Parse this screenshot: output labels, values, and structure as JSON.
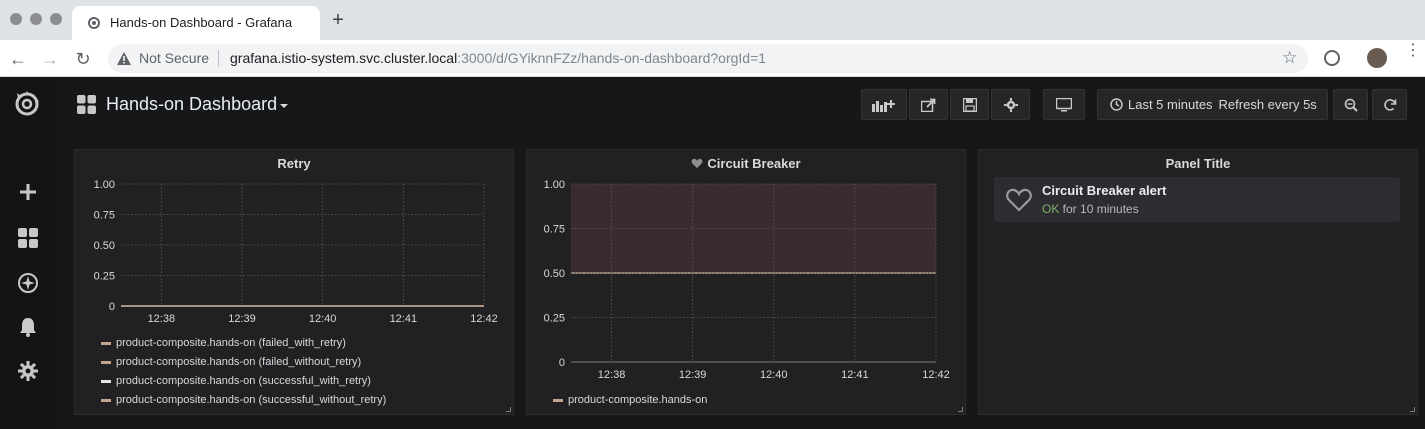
{
  "browser": {
    "tab_title": "Hands-on Dashboard - Grafana",
    "new_tab_label": "+",
    "security_label": "Not Secure",
    "url_host": "grafana.istio-system.svc.cluster.local",
    "url_rest": ":3000/d/GYiknnFZz/hands-on-dashboard?orgId=1"
  },
  "dashboard": {
    "title": "Hands-on Dashboard",
    "time_range": "Last 5 minutes",
    "refresh": "Refresh every 5s"
  },
  "sidebar": {
    "items": [
      {
        "icon": "grafana-logo-icon"
      },
      {
        "icon": "plus-icon"
      },
      {
        "icon": "dashboards-icon"
      },
      {
        "icon": "explore-compass-icon"
      },
      {
        "icon": "bell-icon"
      },
      {
        "icon": "gear-icon"
      }
    ]
  },
  "toolbar_buttons": [
    "add-panel-icon",
    "share-icon",
    "save-icon",
    "gear-icon",
    "tv-icon",
    "clock-icon",
    "zoom-out-icon",
    "refresh-icon"
  ],
  "panels": {
    "retry": {
      "title": "Retry",
      "legend": [
        "product-composite.hands-on (failed_with_retry)",
        "product-composite.hands-on (failed_without_retry)",
        "product-composite.hands-on (successful_with_retry)",
        "product-composite.hands-on (successful_without_retry)"
      ]
    },
    "circuit_breaker": {
      "title": "Circuit Breaker",
      "legend": [
        "product-composite.hands-on"
      ]
    },
    "alert_list": {
      "title": "Panel Title",
      "alert_name": "Circuit Breaker alert",
      "alert_state": "OK",
      "alert_duration": " for 10 minutes"
    }
  },
  "colors": {
    "legend_series": [
      "#c4a38b",
      "#c4a38b",
      "#e8e6e3",
      "#c4a38b"
    ],
    "ok": "#7eb26d",
    "threshold_fill": "#3f2c30",
    "threshold_line": "#b8a78e"
  },
  "chart_data": [
    {
      "type": "line",
      "title": "Retry",
      "x": [
        "12:38",
        "12:39",
        "12:40",
        "12:41",
        "12:42"
      ],
      "ylim": [
        0,
        1
      ],
      "yticks": [
        "1.00",
        "0.75",
        "0.50",
        "0.25",
        "0"
      ],
      "series": [
        {
          "name": "product-composite.hands-on (failed_with_retry)",
          "values": [
            0,
            0,
            0,
            0,
            0
          ]
        },
        {
          "name": "product-composite.hands-on (failed_without_retry)",
          "values": [
            0,
            0,
            0,
            0,
            0
          ]
        },
        {
          "name": "product-composite.hands-on (successful_with_retry)",
          "values": [
            0,
            0,
            0,
            0,
            0
          ]
        },
        {
          "name": "product-composite.hands-on (successful_without_retry)",
          "values": [
            0,
            0,
            0,
            0,
            0
          ]
        }
      ],
      "grid": true,
      "legend": "bottom"
    },
    {
      "type": "line",
      "title": "Circuit Breaker",
      "x": [
        "12:38",
        "12:39",
        "12:40",
        "12:41",
        "12:42"
      ],
      "ylim": [
        0,
        1
      ],
      "yticks": [
        "1.00",
        "0.75",
        "0.50",
        "0.25",
        "0"
      ],
      "threshold": 0.5,
      "series": [
        {
          "name": "product-composite.hands-on",
          "values": []
        }
      ],
      "grid": true,
      "legend": "bottom"
    }
  ]
}
